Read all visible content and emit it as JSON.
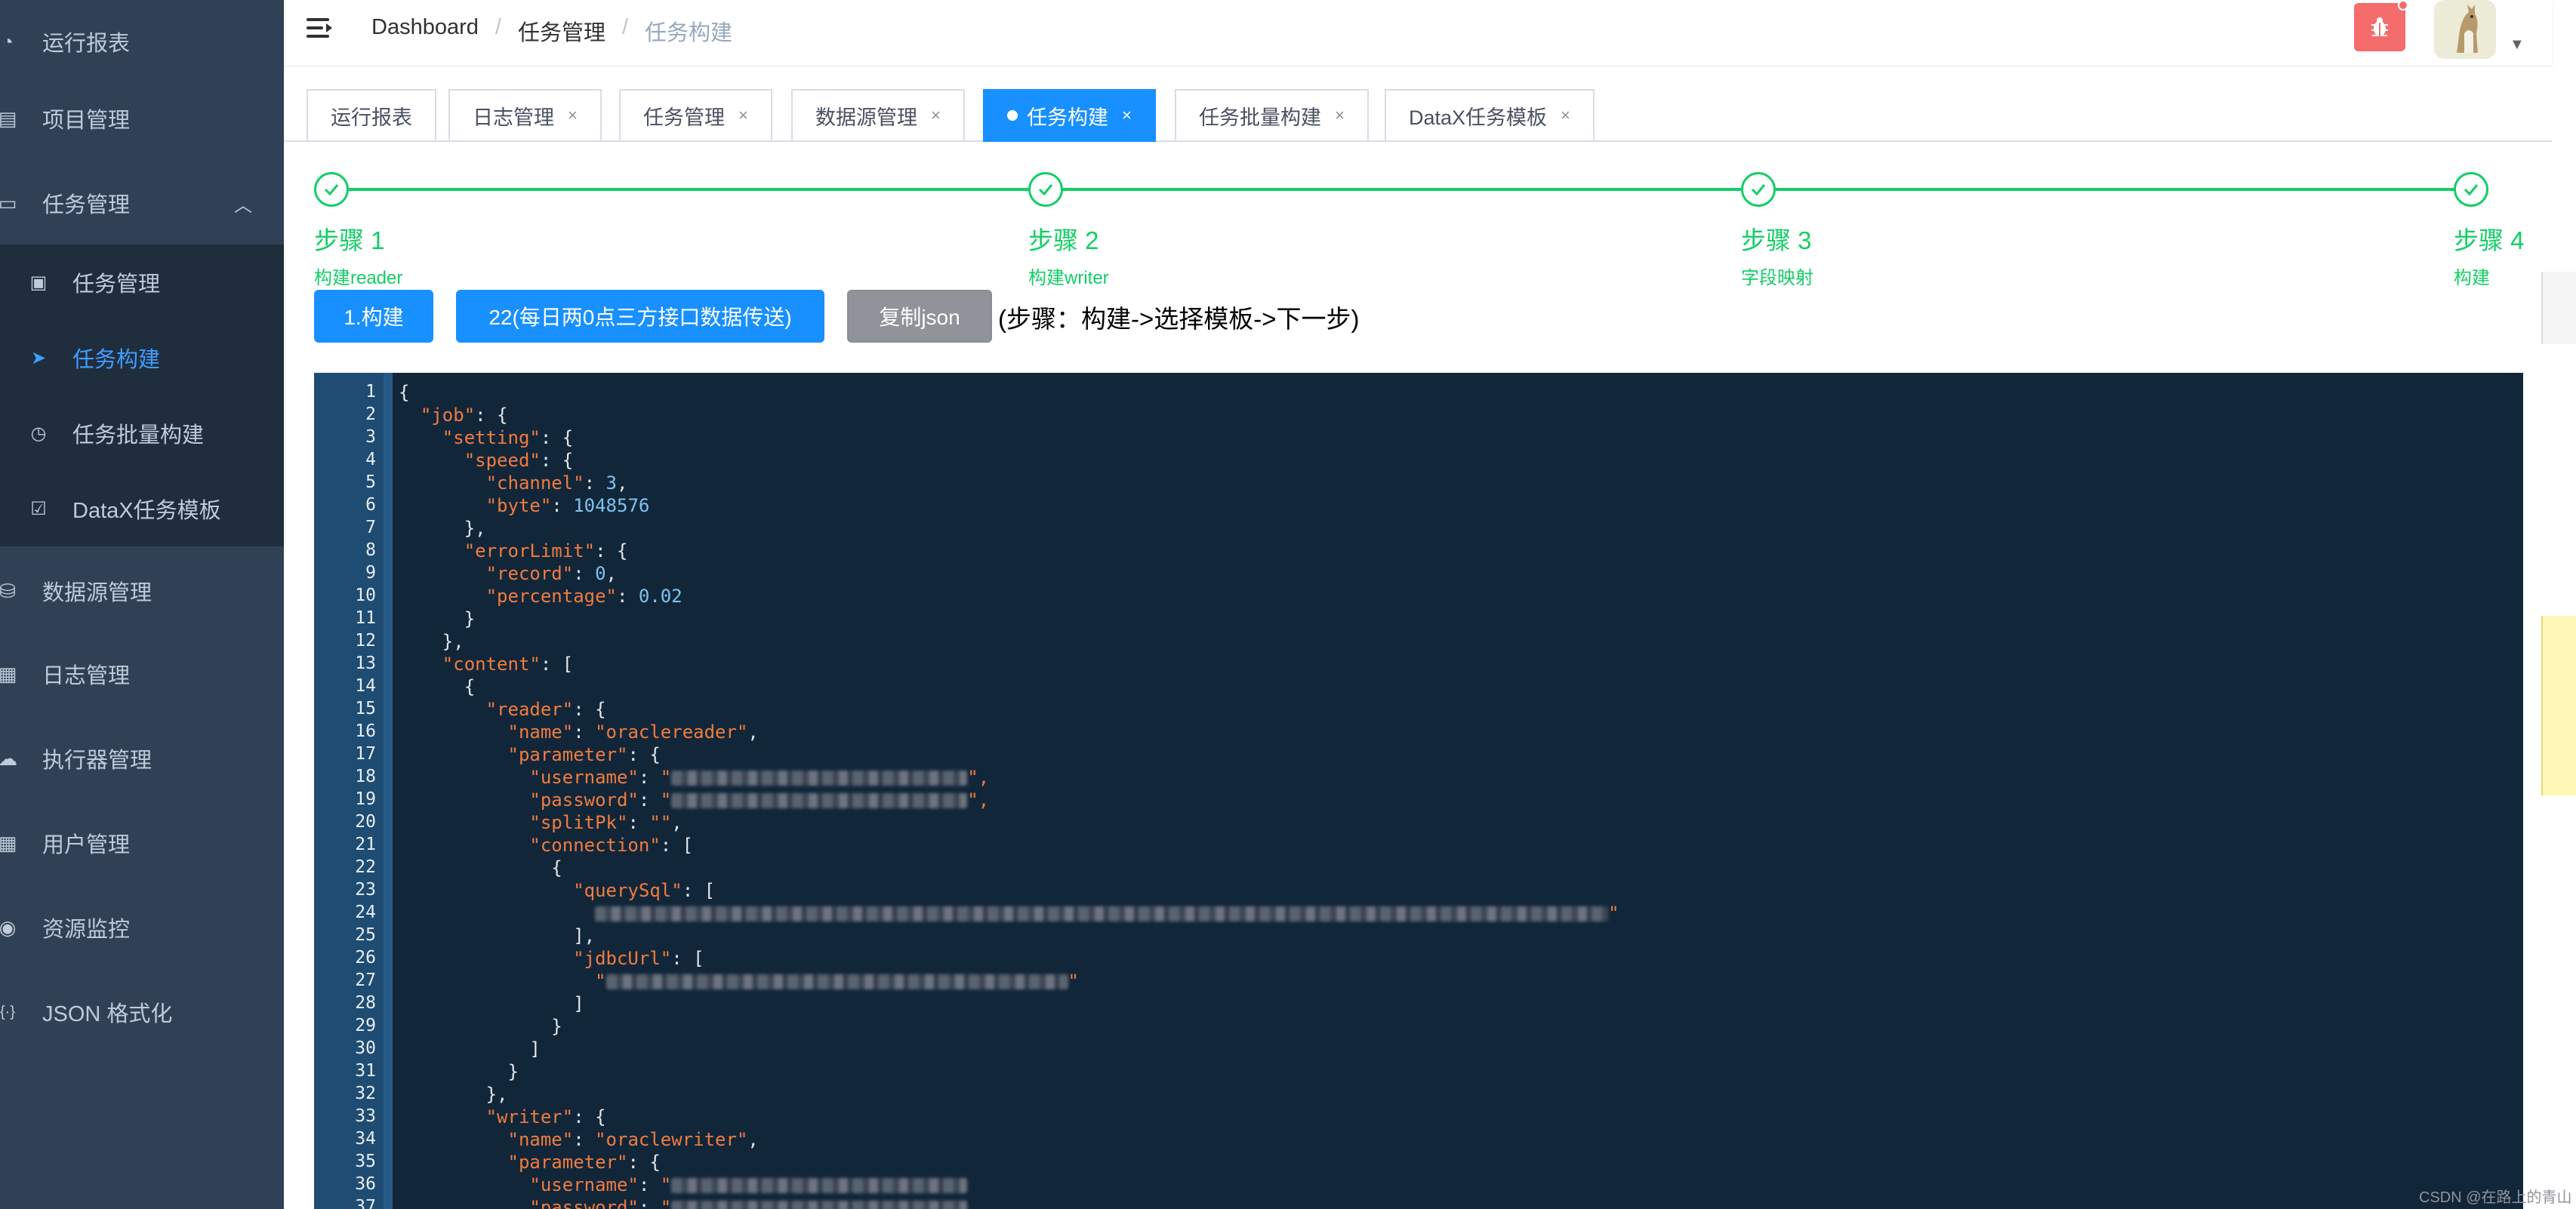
{
  "sidebar": {
    "items": [
      {
        "label": "运行报表",
        "icon": "dashboard-icon",
        "glyph": "◔"
      },
      {
        "label": "项目管理",
        "icon": "project-icon",
        "glyph": "▤"
      },
      {
        "label": "任务管理",
        "icon": "task-icon",
        "glyph": "▭",
        "expanded": true
      },
      {
        "label": "数据源管理",
        "icon": "datasource-icon",
        "glyph": "⛁"
      },
      {
        "label": "日志管理",
        "icon": "log-icon",
        "glyph": "▦"
      },
      {
        "label": "执行器管理",
        "icon": "executor-icon",
        "glyph": "☁"
      },
      {
        "label": "用户管理",
        "icon": "user-table-icon",
        "glyph": "▦"
      },
      {
        "label": "资源监控",
        "icon": "monitor-icon",
        "glyph": "◉"
      },
      {
        "label": "JSON 格式化",
        "icon": "json-icon",
        "glyph": "{·}"
      }
    ],
    "submenu": [
      {
        "label": "任务管理",
        "icon": "calendar-icon",
        "glyph": "▣"
      },
      {
        "label": "任务构建",
        "icon": "paper-plane-icon",
        "glyph": "➤",
        "active": true
      },
      {
        "label": "任务批量构建",
        "icon": "gauge-icon",
        "glyph": "◷"
      },
      {
        "label": "DataX任务模板",
        "icon": "clipboard-icon",
        "glyph": "☑"
      }
    ],
    "active_color": "#409eff"
  },
  "navbar": {
    "breadcrumb": [
      "Dashboard",
      "任务管理",
      "任务构建"
    ]
  },
  "tags": [
    {
      "label": "运行报表",
      "closable": false
    },
    {
      "label": "日志管理",
      "closable": true
    },
    {
      "label": "任务管理",
      "closable": true
    },
    {
      "label": "数据源管理",
      "closable": true
    },
    {
      "label": "任务构建",
      "closable": true,
      "active": true
    },
    {
      "label": "任务批量构建",
      "closable": true
    },
    {
      "label": "DataX任务模板",
      "closable": true
    }
  ],
  "close_glyph": "×",
  "steps": [
    {
      "title": "步骤 1",
      "desc": "构建reader"
    },
    {
      "title": "步骤 2",
      "desc": "构建writer"
    },
    {
      "title": "步骤 3",
      "desc": "字段映射"
    },
    {
      "title": "步骤 4",
      "desc": "构建"
    }
  ],
  "step_color": "#13ce66",
  "actions": {
    "build_label": "1.构建",
    "template_label": "22(每日两0点三方接口数据传送)",
    "copy_label": "复制json",
    "hint": "(步骤：构建->选择模板->下一步)"
  },
  "editor": {
    "line_numbers": [
      "1",
      "2",
      "3",
      "4",
      "5",
      "6",
      "7",
      "8",
      "9",
      "10",
      "11",
      "12",
      "13",
      "14",
      "15",
      "16",
      "17",
      "18",
      "19",
      "20",
      "21",
      "22",
      "23",
      "24",
      "25",
      "26",
      "27",
      "28",
      "29",
      "30",
      "31",
      "32",
      "33",
      "34",
      "35",
      "36",
      "37"
    ],
    "tokens": {
      "brace_open": "{",
      "brace_close": "}",
      "bracket_open": "[",
      "bracket_close": "]",
      "colon_brace": ": {",
      "colon_bracket": ": [",
      "colon": ": ",
      "comma": ",",
      "close_brace_comma": "},",
      "close_bracket_comma": "],",
      "quote": "\"",
      "quote_comma": "\","
    },
    "keys": {
      "job": "\"job\"",
      "setting": "\"setting\"",
      "speed": "\"speed\"",
      "channel": "\"channel\"",
      "byte": "\"byte\"",
      "errorLimit": "\"errorLimit\"",
      "record": "\"record\"",
      "percentage": "\"percentage\"",
      "content": "\"content\"",
      "reader": "\"reader\"",
      "name": "\"name\"",
      "parameter": "\"parameter\"",
      "username": "\"username\"",
      "password": "\"password\"",
      "splitPk": "\"splitPk\"",
      "connection": "\"connection\"",
      "querySql": "\"querySql\"",
      "jdbcUrl": "\"jdbcUrl\"",
      "writer": "\"writer\""
    },
    "values": {
      "channel": "3",
      "byte": "1048576",
      "record": "0",
      "percentage": "0.02",
      "reader_name": "\"oraclereader\"",
      "splitPk": "\"\"",
      "writer_name": "\"oraclewriter\""
    }
  },
  "watermark": "CSDN @在路上的青山"
}
